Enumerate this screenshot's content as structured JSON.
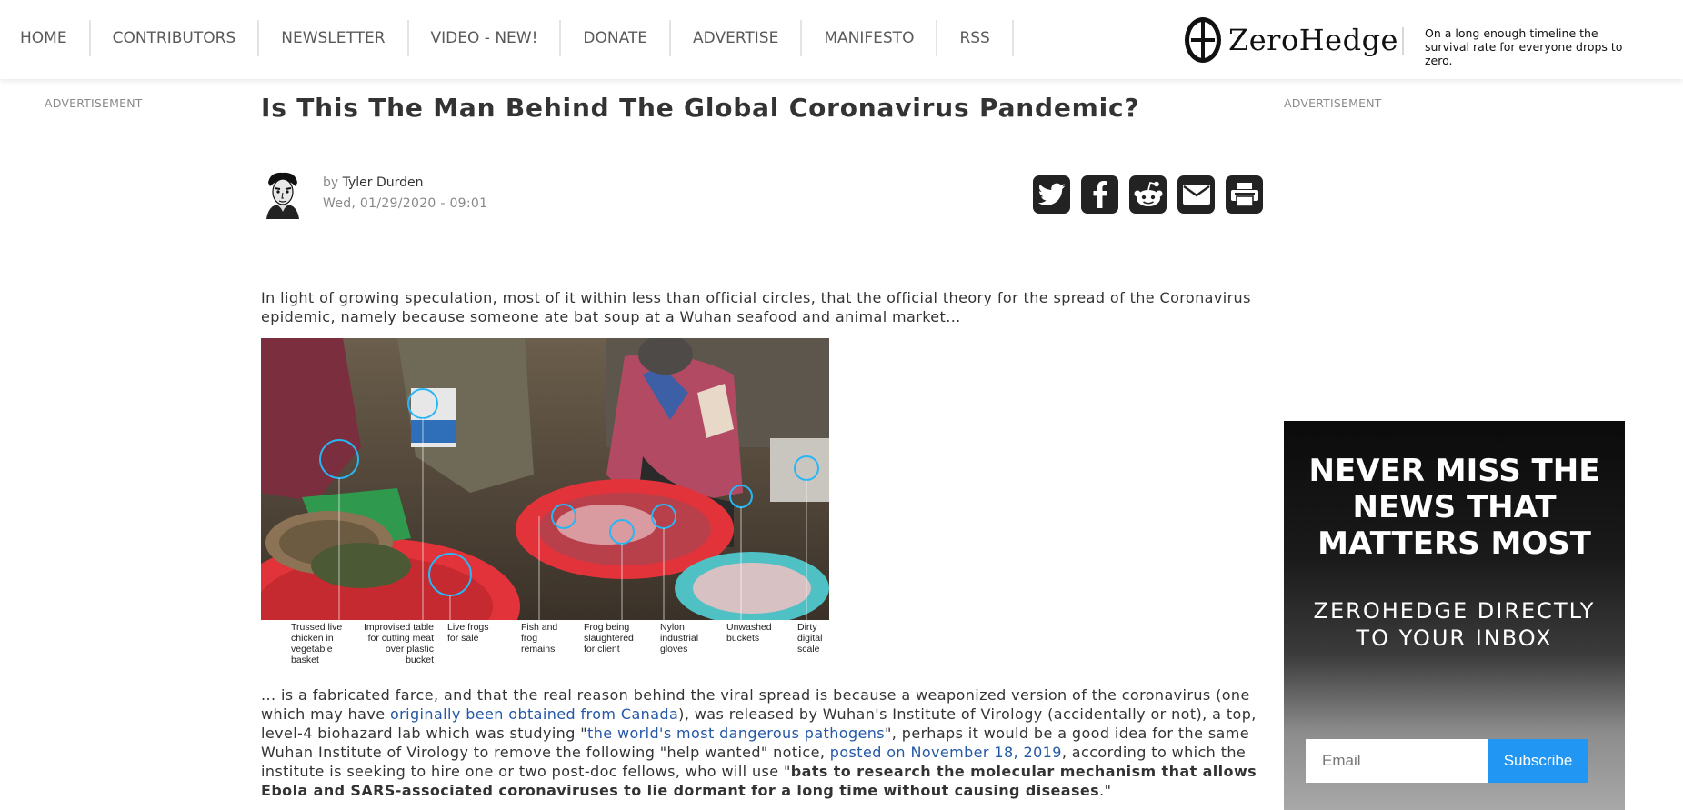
{
  "header": {
    "nav": [
      {
        "label": "HOME"
      },
      {
        "label": "CONTRIBUTORS"
      },
      {
        "label": "NEWSLETTER"
      },
      {
        "label": "VIDEO - NEW!"
      },
      {
        "label": "DONATE"
      },
      {
        "label": "ADVERTISE"
      },
      {
        "label": "MANIFESTO"
      },
      {
        "label": "RSS"
      }
    ],
    "logo_text": "ZeroHedge",
    "tagline": "On a long enough timeline the survival rate for everyone drops to zero."
  },
  "ads": {
    "left_label": "ADVERTISEMENT",
    "right_label": "ADVERTISEMENT"
  },
  "article": {
    "title": "Is This The Man Behind The Global Coronavirus Pandemic?",
    "by_prefix": "by",
    "author": "Tyler Durden",
    "date": "Wed, 01/29/2020 - 09:01",
    "share_icons": [
      "twitter-icon",
      "facebook-icon",
      "reddit-icon",
      "email-icon",
      "print-icon"
    ],
    "intro": "In light of growing speculation, most of it within less than official circles, that the official theory for the spread of the Coronavirus epidemic, namely because someone ate bat soup at a Wuhan seafood and animal market...",
    "figure_captions": [
      "Trussed live chicken in vegetable basket",
      "Improvised table for cutting meat over plastic bucket",
      "Live frogs for sale",
      "Fish and frog remains",
      "Frog being slaughtered for client",
      "Nylon industrial gloves",
      "Unwashed buckets",
      "Dirty digital scale"
    ],
    "body": {
      "t1": "... is a fabricated farce, and that the real reason behind the viral spread is because a weaponized version of the coronavirus (one which may have ",
      "link1": "originally been obtained from Canada",
      "t2": "), was released by Wuhan's Institute of Virology (accidentally or not), a top, level-4 biohazard lab which was studying \"",
      "link2": "the world's most dangerous pathogens",
      "t3": "\", perhaps it would be a good idea for the same Wuhan Institute of Virology to remove the following \"help wanted\" notice, ",
      "link3": "posted on November 18, 2019",
      "t4": ", according to which the institute is seeking to hire one or two post-doc fellows, who will use \"",
      "bold1": "bats to research the molecular mechanism that allows Ebola and SARS-associated coronaviruses to lie dormant for a long time without causing diseases",
      "t5": ".\""
    }
  },
  "newsletter": {
    "headline_lines": [
      "NEVER MISS THE",
      "NEWS THAT",
      "MATTERS MOST"
    ],
    "sub_lines": [
      "ZEROHEDGE DIRECTLY",
      "TO YOUR INBOX"
    ],
    "email_placeholder": "Email",
    "subscribe_label": "Subscribe",
    "button_color": "#2196f3"
  }
}
